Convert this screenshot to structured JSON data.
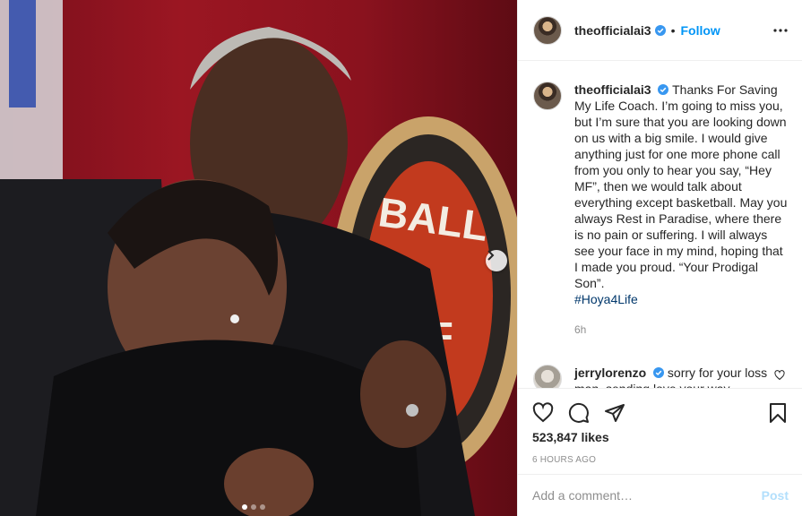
{
  "photo": {
    "alt_icons": [
      "chevron-right-icon"
    ],
    "carousel": {
      "count": 3,
      "active": 1
    }
  },
  "header": {
    "username": "theofficialai3",
    "separator": "•",
    "follow_label": "Follow"
  },
  "caption": {
    "username": "theofficialai3",
    "text": "Thanks For Saving My Life Coach. I’m going to miss you, but I’m sure that you are looking down on us with a big smile. I would give anything just for one more phone call from you only to hear you say, “Hey MF”, then we would talk about everything except basketball. May you always Rest in Paradise, where there is no pain or suffering. I will always see your face in my mind, hoping that I made you proud. “Your Prodigal Son”.",
    "hashtag": "#Hoya4Life",
    "time": "6h"
  },
  "comment": {
    "username": "jerrylorenzo",
    "text": "sorry for your loss man. sending love your way. Georgetown was an hbcu in my mind as a kid cause of this man"
  },
  "actions": {
    "likes": "523,847 likes",
    "ago": "6 HOURS AGO"
  },
  "add_comment": {
    "placeholder": "Add a comment…",
    "post_label": "Post"
  },
  "colors": {
    "accent": "#0095f6",
    "post_disabled": "#b2dffc",
    "muted": "#8e8e8e",
    "photo_background": "#9b1622"
  }
}
